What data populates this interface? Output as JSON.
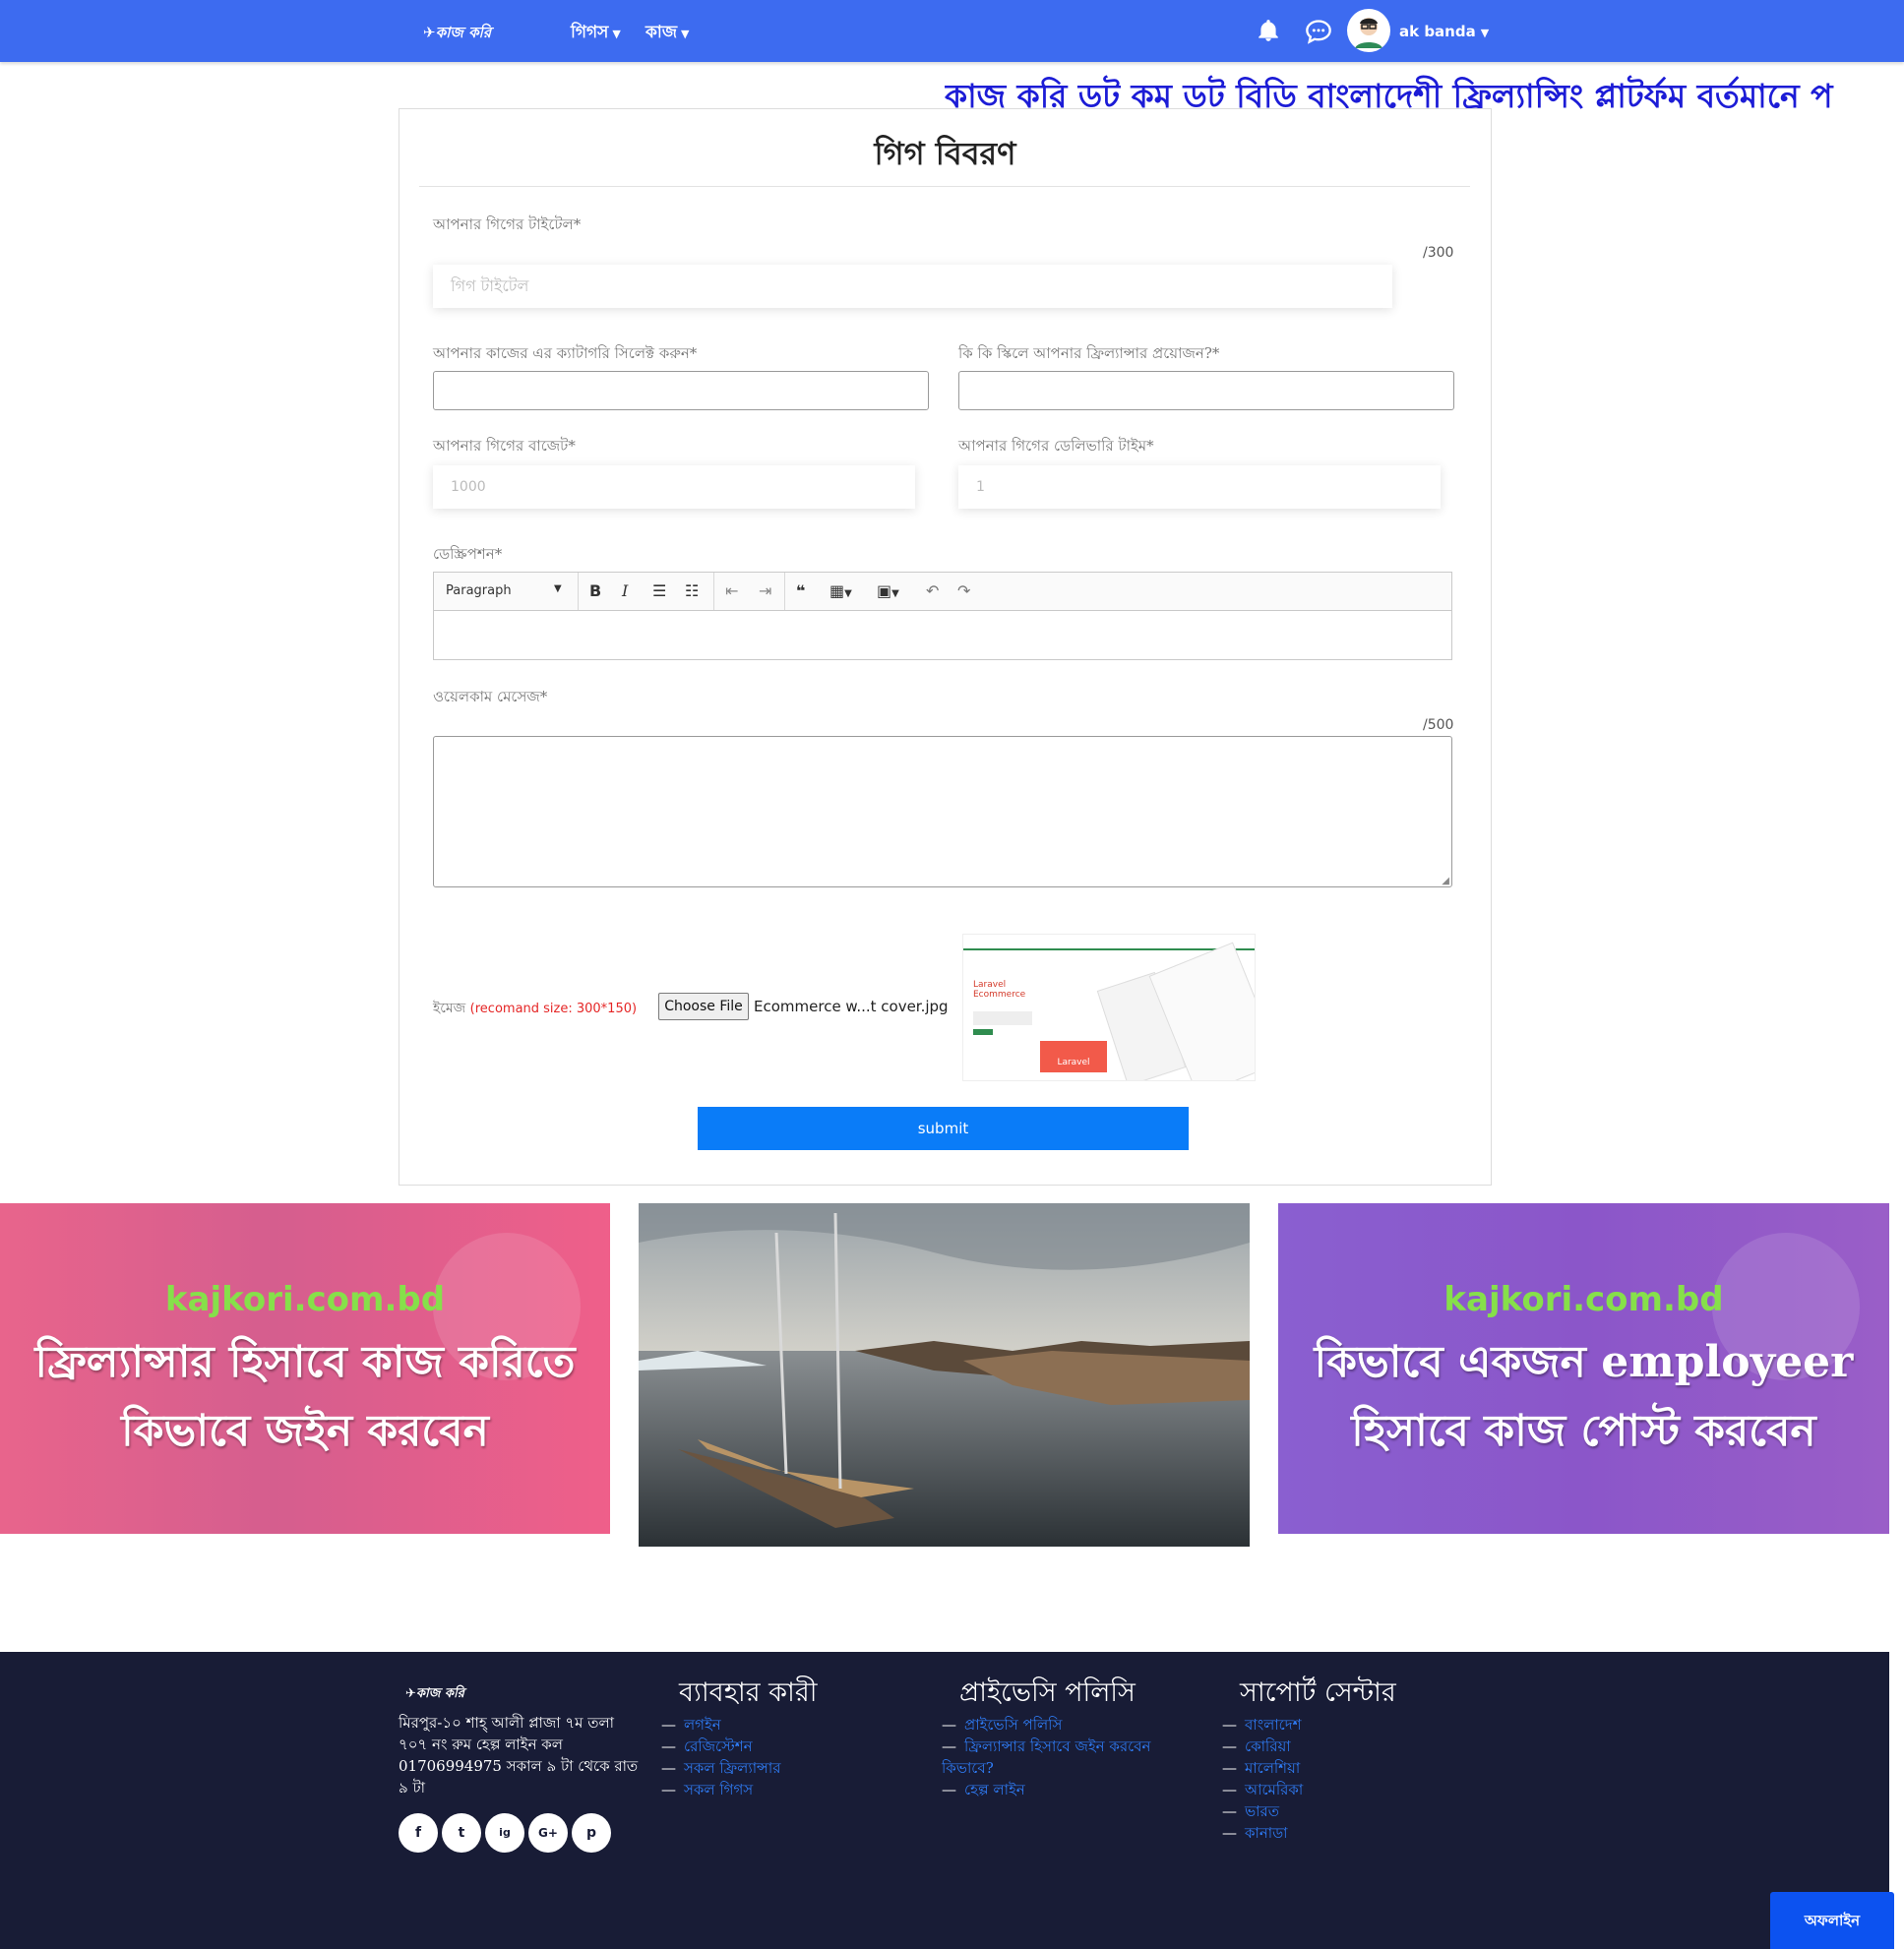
{
  "navbar": {
    "logo_text": "কাজ করি",
    "menu": [
      {
        "label": "গিগস"
      },
      {
        "label": "কাজ"
      }
    ],
    "user_name": "ak banda"
  },
  "marquee_text": "কাজ করি ডট কম ডট বিডি বাংলাদেশী ফ্রিল্যান্সিং প্লাটর্ফম বর্তমানে প",
  "form": {
    "title": "গিগ বিবরণ",
    "gig_title_label": "আপনার গিগের টাইটেল*",
    "gig_title_counter": "/300",
    "gig_title_placeholder": "গিগ টাইটেল",
    "category_label": "আপনার কাজের এর ক্যাটাগরি সিলেক্ট করুন*",
    "skills_label": "কি কি স্কিলে আপনার ফ্রিল্যান্সার প্রয়োজন?*",
    "budget_label": "আপনার গিগের বাজেট*",
    "budget_placeholder": "1000",
    "delivery_label": "আপনার গিগের ডেলিভারি টাইম*",
    "delivery_placeholder": "1",
    "description_label": "ডেস্ক্রিপশন*",
    "editor_paragraph": "Paragraph",
    "welcome_label": "ওয়েলকাম মেসেজ*",
    "welcome_counter": "/500",
    "image_label": "ইমেজ",
    "image_hint": "(recomand size: 300*150)",
    "choose_file": "Choose File",
    "file_name": "Ecommerce w...t cover.jpg",
    "thumb_title": "Laravel Ecommerce",
    "thumb_badge": "Laravel",
    "submit": "submit"
  },
  "banners": [
    {
      "site": "kajkori.com.bd",
      "line1": "ফ্রিল্যান্সার হিসাবে কাজ করিতে",
      "line2": "কিভাবে জইন করবেন"
    },
    {},
    {
      "site": "kajkori.com.bd",
      "line1": "কিভাবে একজন employeer",
      "line2": "হিসাবে কাজ পোস্ট করবেন"
    }
  ],
  "footer": {
    "logo_text": "কাজ করি",
    "address": "মিরপুর-১০ শাহ্ আলী প্লাজা ৭ম তলা ৭০৭ নং রুম হেল্প লাইন কল 01706994975 সকাল ৯ টা থেকে রাত ৯ টা",
    "social": [
      "f",
      "t",
      "ig",
      "G+",
      "p"
    ],
    "columns": [
      {
        "heading": "ব্যাবহার কারী",
        "links": [
          "লগইন",
          "রেজিস্টেশন",
          "সকল ফ্রিল্যান্সার",
          "সকল গিগস"
        ]
      },
      {
        "heading": "প্রাইভেসি পলিসি",
        "links": [
          "প্রাইভেসি পলিসি",
          "ফ্রিল্যান্সার হিসাবে জইন করবেন কিভাবে?",
          "হেল্প লাইন"
        ]
      },
      {
        "heading": "সাপোর্ট সেন্টার",
        "links": [
          "বাংলাদেশ",
          "কোরিয়া",
          "মালেশিয়া",
          "আমেরিকা",
          "ভারত",
          "কানাডা"
        ]
      }
    ]
  },
  "status_button": "অফলাইন",
  "colors": {
    "navbar": "#3d6bf0",
    "submit": "#0a7cf8",
    "footer": "#181c36",
    "link": "#2f7cf6",
    "marquee": "#1c1cd6"
  }
}
